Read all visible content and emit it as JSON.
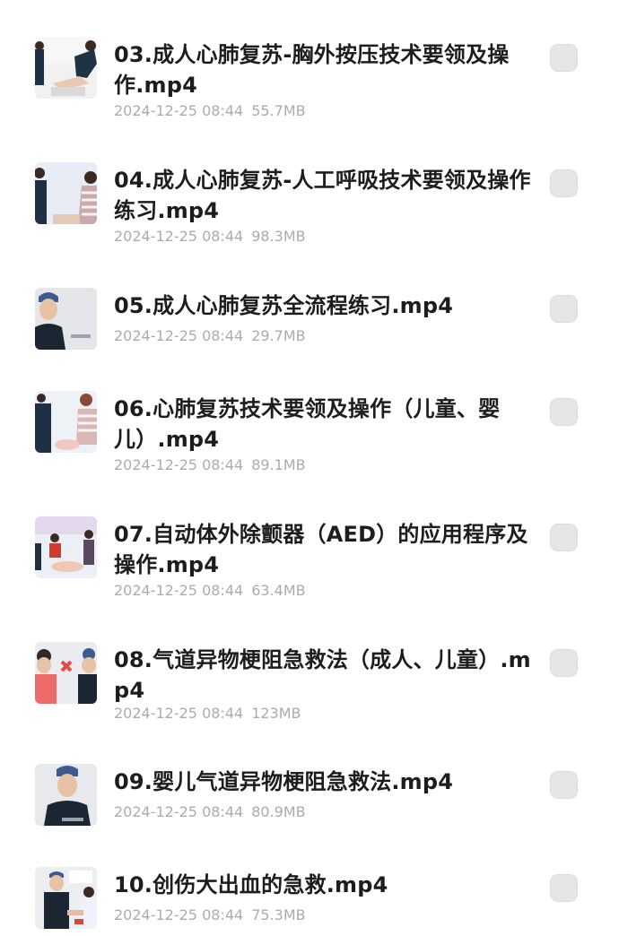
{
  "files": [
    {
      "name": "03.成人心肺复苏-胸外按压技术要领及操作.mp4",
      "date": "2024-12-25 08:44",
      "size": "55.7MB",
      "icon": "video-thumbnail-icon"
    },
    {
      "name": "04.成人心肺复苏-人工呼吸技术要领及操作练习.mp4",
      "date": "2024-12-25 08:44",
      "size": "98.3MB",
      "icon": "video-thumbnail-icon"
    },
    {
      "name": "05.成人心肺复苏全流程练习.mp4",
      "date": "2024-12-25 08:44",
      "size": "29.7MB",
      "icon": "video-thumbnail-icon"
    },
    {
      "name": "06.心肺复苏技术要领及操作（儿童、婴儿）.mp4",
      "date": "2024-12-25 08:44",
      "size": "89.1MB",
      "icon": "video-thumbnail-icon"
    },
    {
      "name": "07.自动体外除颤器（AED）的应用程序及操作.mp4",
      "date": "2024-12-25 08:44",
      "size": "63.4MB",
      "icon": "video-thumbnail-icon"
    },
    {
      "name": "08.气道异物梗阻急救法（成人、儿童）.mp4",
      "date": "2024-12-25 08:44",
      "size": "123MB",
      "icon": "video-thumbnail-icon"
    },
    {
      "name": "09.婴儿气道异物梗阻急救法.mp4",
      "date": "2024-12-25 08:44",
      "size": "80.9MB",
      "icon": "video-thumbnail-icon"
    },
    {
      "name": "10.创伤大出血的急救.mp4",
      "date": "2024-12-25 08:44",
      "size": "75.3MB",
      "icon": "video-thumbnail-icon"
    }
  ],
  "colors": {
    "title": "#1d1d1f",
    "meta": "#a8acb3",
    "checkbox": "#e6e6e8"
  }
}
